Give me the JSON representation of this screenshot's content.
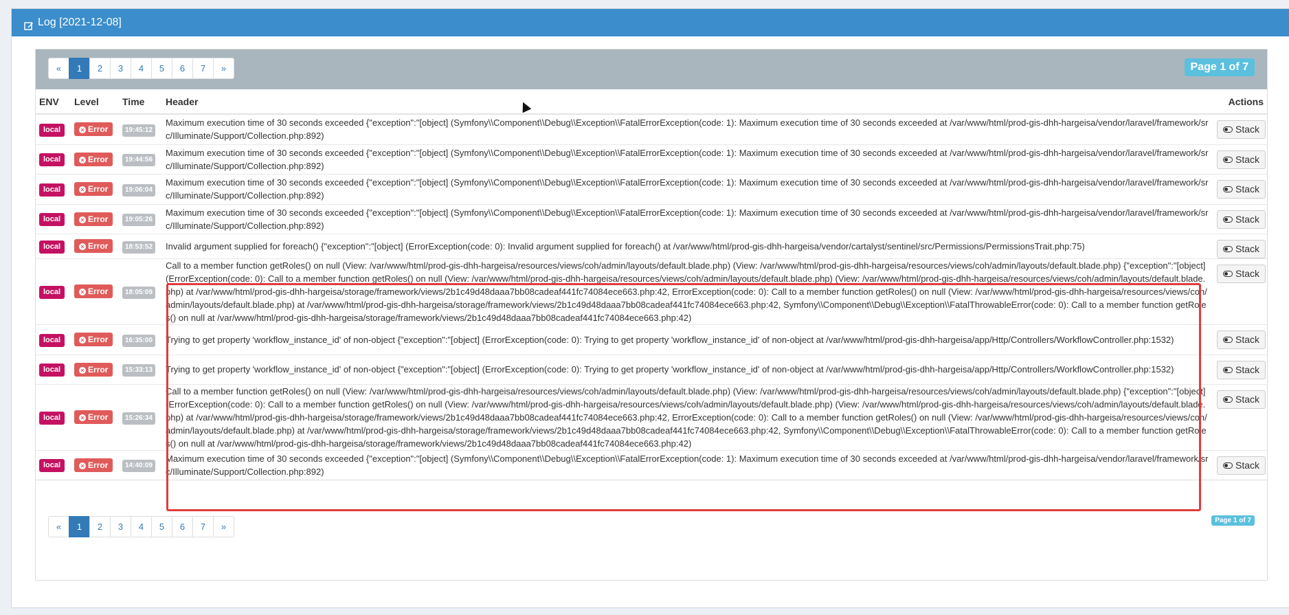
{
  "panel": {
    "title": "Log [2021-12-08]",
    "icon": "edit-icon"
  },
  "pagination": {
    "prev": "«",
    "next": "»",
    "pages": [
      "1",
      "2",
      "3",
      "4",
      "5",
      "6",
      "7"
    ],
    "active": "1",
    "page_label": "Page 1 of 7"
  },
  "table": {
    "headers": {
      "env": "ENV",
      "level": "Level",
      "time": "Time",
      "header": "Header",
      "actions": "Actions"
    },
    "stack_label": "Stack",
    "rows": [
      {
        "env": "local",
        "level": "Error",
        "time": "19:45:12",
        "header": "Maximum execution time of 30 seconds exceeded {\"exception\":\"[object] (Symfony\\\\Component\\\\Debug\\\\Exception\\\\FatalErrorException(code: 1): Maximum execution time of 30 seconds exceeded at /var/www/html/prod-gis-dhh-hargeisa/vendor/laravel/framework/src/Illuminate/Support/Collection.php:892)"
      },
      {
        "env": "local",
        "level": "Error",
        "time": "19:44:56",
        "header": "Maximum execution time of 30 seconds exceeded {\"exception\":\"[object] (Symfony\\\\Component\\\\Debug\\\\Exception\\\\FatalErrorException(code: 1): Maximum execution time of 30 seconds exceeded at /var/www/html/prod-gis-dhh-hargeisa/vendor/laravel/framework/src/Illuminate/Support/Collection.php:892)"
      },
      {
        "env": "local",
        "level": "Error",
        "time": "19:06:04",
        "header": "Maximum execution time of 30 seconds exceeded {\"exception\":\"[object] (Symfony\\\\Component\\\\Debug\\\\Exception\\\\FatalErrorException(code: 1): Maximum execution time of 30 seconds exceeded at /var/www/html/prod-gis-dhh-hargeisa/vendor/laravel/framework/src/Illuminate/Support/Collection.php:892)"
      },
      {
        "env": "local",
        "level": "Error",
        "time": "19:05:26",
        "header": "Maximum execution time of 30 seconds exceeded {\"exception\":\"[object] (Symfony\\\\Component\\\\Debug\\\\Exception\\\\FatalErrorException(code: 1): Maximum execution time of 30 seconds exceeded at /var/www/html/prod-gis-dhh-hargeisa/vendor/laravel/framework/src/Illuminate/Support/Collection.php:892)"
      },
      {
        "env": "local",
        "level": "Error",
        "time": "18:53:52",
        "header": "Invalid argument supplied for foreach() {\"exception\":\"[object] (ErrorException(code: 0): Invalid argument supplied for foreach() at /var/www/html/prod-gis-dhh-hargeisa/vendor/cartalyst/sentinel/src/Permissions/PermissionsTrait.php:75)"
      },
      {
        "env": "local",
        "level": "Error",
        "time": "18:05:09",
        "header": "Call to a member function getRoles() on null (View: /var/www/html/prod-gis-dhh-hargeisa/resources/views/coh/admin/layouts/default.blade.php) (View: /var/www/html/prod-gis-dhh-hargeisa/resources/views/coh/admin/layouts/default.blade.php) {\"exception\":\"[object] (ErrorException(code: 0): Call to a member function getRoles() on null (View: /var/www/html/prod-gis-dhh-hargeisa/resources/views/coh/admin/layouts/default.blade.php) (View: /var/www/html/prod-gis-dhh-hargeisa/resources/views/coh/admin/layouts/default.blade.php) at /var/www/html/prod-gis-dhh-hargeisa/storage/framework/views/2b1c49d48daaa7bb08cadeaf441fc74084ece663.php:42, ErrorException(code: 0): Call to a member function getRoles() on null (View: /var/www/html/prod-gis-dhh-hargeisa/resources/views/coh/admin/layouts/default.blade.php) at /var/www/html/prod-gis-dhh-hargeisa/storage/framework/views/2b1c49d48daaa7bb08cadeaf441fc74084ece663.php:42, Symfony\\\\Component\\\\Debug\\\\Exception\\\\FatalThrowableError(code: 0): Call to a member function getRoles() on null at /var/www/html/prod-gis-dhh-hargeisa/storage/framework/views/2b1c49d48daaa7bb08cadeaf441fc74084ece663.php:42)"
      },
      {
        "env": "local",
        "level": "Error",
        "time": "16:35:00",
        "header": "Trying to get property 'workflow_instance_id' of non-object {\"exception\":\"[object] (ErrorException(code: 0): Trying to get property 'workflow_instance_id' of non-object at /var/www/html/prod-gis-dhh-hargeisa/app/Http/Controllers/WorkflowController.php:1532)"
      },
      {
        "env": "local",
        "level": "Error",
        "time": "15:33:13",
        "header": "Trying to get property 'workflow_instance_id' of non-object {\"exception\":\"[object] (ErrorException(code: 0): Trying to get property 'workflow_instance_id' of non-object at /var/www/html/prod-gis-dhh-hargeisa/app/Http/Controllers/WorkflowController.php:1532)"
      },
      {
        "env": "local",
        "level": "Error",
        "time": "15:26:34",
        "header": "Call to a member function getRoles() on null (View: /var/www/html/prod-gis-dhh-hargeisa/resources/views/coh/admin/layouts/default.blade.php) (View: /var/www/html/prod-gis-dhh-hargeisa/resources/views/coh/admin/layouts/default.blade.php) {\"exception\":\"[object] (ErrorException(code: 0): Call to a member function getRoles() on null (View: /var/www/html/prod-gis-dhh-hargeisa/resources/views/coh/admin/layouts/default.blade.php) (View: /var/www/html/prod-gis-dhh-hargeisa/resources/views/coh/admin/layouts/default.blade.php) at /var/www/html/prod-gis-dhh-hargeisa/storage/framework/views/2b1c49d48daaa7bb08cadeaf441fc74084ece663.php:42, ErrorException(code: 0): Call to a member function getRoles() on null (View: /var/www/html/prod-gis-dhh-hargeisa/resources/views/coh/admin/layouts/default.blade.php) at /var/www/html/prod-gis-dhh-hargeisa/storage/framework/views/2b1c49d48daaa7bb08cadeaf441fc74084ece663.php:42, Symfony\\\\Component\\\\Debug\\\\Exception\\\\FatalThrowableError(code: 0): Call to a member function getRoles() on null at /var/www/html/prod-gis-dhh-hargeisa/storage/framework/views/2b1c49d48daaa7bb08cadeaf441fc74084ece663.php:42)"
      },
      {
        "env": "local",
        "level": "Error",
        "time": "14:40:09",
        "header": "Maximum execution time of 30 seconds exceeded {\"exception\":\"[object] (Symfony\\\\Component\\\\Debug\\\\Exception\\\\FatalErrorException(code: 1): Maximum execution time of 30 seconds exceeded at /var/www/html/prod-gis-dhh-hargeisa/vendor/laravel/framework/src/Illuminate/Support/Collection.php:892)"
      }
    ]
  }
}
